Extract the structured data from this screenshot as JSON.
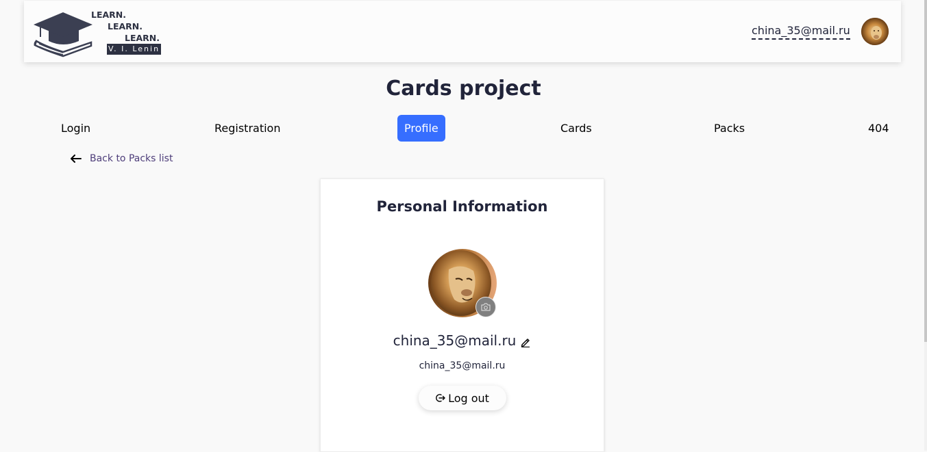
{
  "header": {
    "logo": {
      "line1": "LEARN.",
      "line2": "LEARN.",
      "line3": "LEARN.",
      "signature": "V. I. Lenin"
    },
    "user_email": "china_35@mail.ru",
    "avatar_icon": "lion-avatar-icon"
  },
  "page": {
    "title": "Cards project"
  },
  "nav": {
    "items": [
      {
        "label": "Login",
        "active": false
      },
      {
        "label": "Registration",
        "active": false
      },
      {
        "label": "Profile",
        "active": true
      },
      {
        "label": "Cards",
        "active": false
      },
      {
        "label": "Packs",
        "active": false
      },
      {
        "label": "404",
        "active": false
      }
    ]
  },
  "back_link": {
    "label": "Back to Packs list",
    "icon": "arrow-left-icon"
  },
  "profile": {
    "title": "Personal Information",
    "name": "china_35@mail.ru",
    "email": "china_35@mail.ru",
    "logout_label": "Log out",
    "camera_icon": "camera-icon",
    "edit_icon": "pencil-icon",
    "logout_icon": "logout-icon"
  },
  "colors": {
    "accent": "#366eff",
    "text": "#21243a",
    "link": "#4e3e7a",
    "background": "#f9f9f9"
  }
}
